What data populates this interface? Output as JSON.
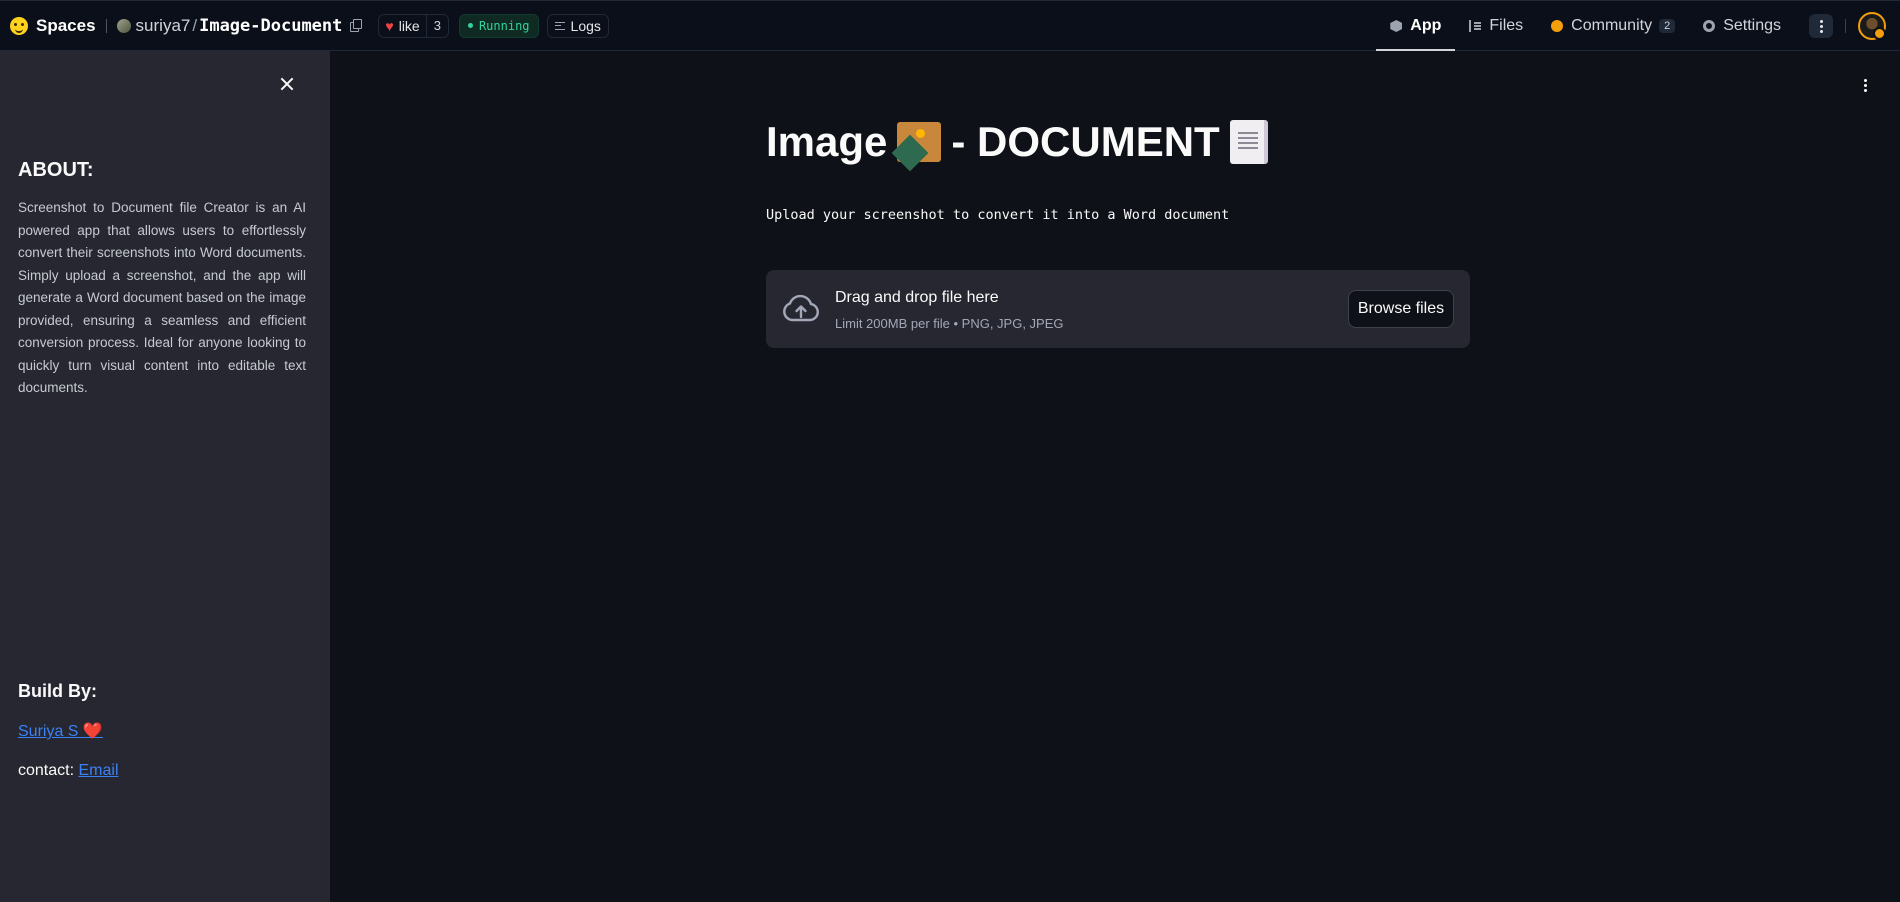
{
  "topbar": {
    "spaces_label": "Spaces",
    "owner": "suriya7",
    "slash": "/",
    "repo": "Image-Document",
    "like_label": "like",
    "like_count": "3",
    "status": "Running",
    "logs_label": "Logs",
    "nav": {
      "app": "App",
      "files": "Files",
      "community": "Community",
      "community_count": "2",
      "settings": "Settings"
    }
  },
  "sidebar": {
    "about_title": "ABOUT:",
    "about_text": "Screenshot to Document file Creator is an AI powered app that allows users to effortlessly convert their screenshots into Word documents. Simply upload a screenshot, and the app will generate a Word document based on the image provided, ensuring a seamless and efficient conversion process. Ideal for anyone looking to quickly turn visual content into editable text documents.",
    "build_title": "Build By:",
    "author": "Suriya S",
    "author_heart": "❤️",
    "contact_label": "contact: ",
    "email_label": "Email"
  },
  "main": {
    "title_word1": "Image",
    "title_word2": " - DOCUMENT",
    "subtitle": "Upload your screenshot to convert it into a Word document",
    "uploader": {
      "drop_title": "Drag and drop file here",
      "limit": "Limit 200MB per file • PNG, JPG, JPEG",
      "browse_label": "Browse files"
    }
  },
  "colors": {
    "background": "#0e1117",
    "sidebar": "#262730",
    "link": "#3b82f6",
    "status_green": "#34d399",
    "like_red": "#ef4444"
  }
}
